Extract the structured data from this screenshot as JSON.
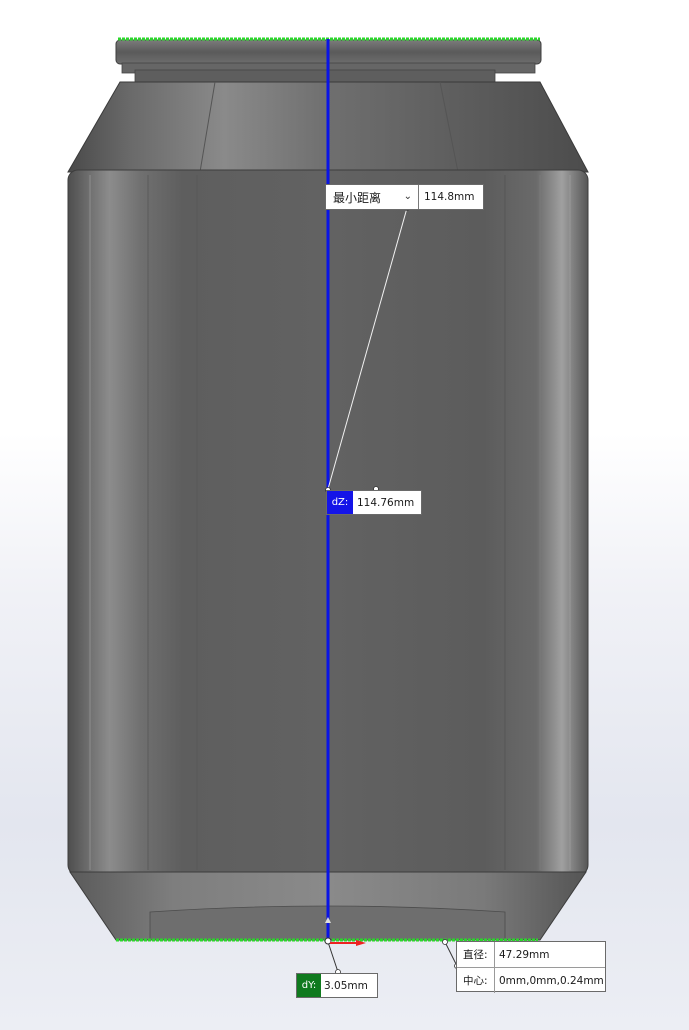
{
  "min_distance": {
    "mode_label": "最小距离",
    "value": "114.8mm"
  },
  "dz": {
    "tag": "dZ:",
    "value": "114.76mm"
  },
  "dy": {
    "tag": "dY:",
    "value": "3.05mm"
  },
  "circle_info": {
    "diameter_label": "直径:",
    "diameter_value": "47.29mm",
    "center_label": "中心:",
    "center_value": "0mm,0mm,0.24mm"
  },
  "colors": {
    "measure_line": "#0a14e6",
    "selected_edge": "#2bd62b",
    "dz_tag_bg": "#1414e8",
    "dy_tag_bg": "#0f7a1e",
    "model_body": "#6b6b6b"
  },
  "icons": {
    "mode_dropdown": "chevron-down-icon",
    "axis_triad": "axis-arrow-icon"
  }
}
